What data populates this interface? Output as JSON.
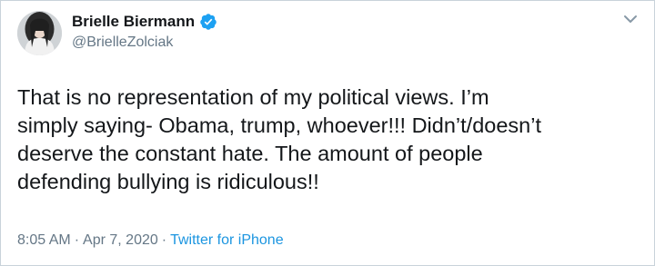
{
  "tweet": {
    "author": {
      "display_name": "Brielle Biermann",
      "handle": "@BrielleZolciak",
      "verified": true,
      "verified_icon": "verified-badge-icon"
    },
    "text": "That is no representation of my political views. I’m\nsimply saying- Obama, trump, whoever!!! Didn’t/doesn’t\ndeserve the constant hate. The amount of people\ndefending bullying is ridiculous!!",
    "time": "8:05 AM",
    "separator_1": "·",
    "date": "Apr 7, 2020",
    "separator_2": "·",
    "source": "Twitter for iPhone",
    "menu_icon": "chevron-down-icon"
  },
  "colors": {
    "text": "#14171a",
    "secondary": "#657786",
    "link": "#1b95e0",
    "verified": "#1da1f2",
    "border": "#c9d3da"
  }
}
